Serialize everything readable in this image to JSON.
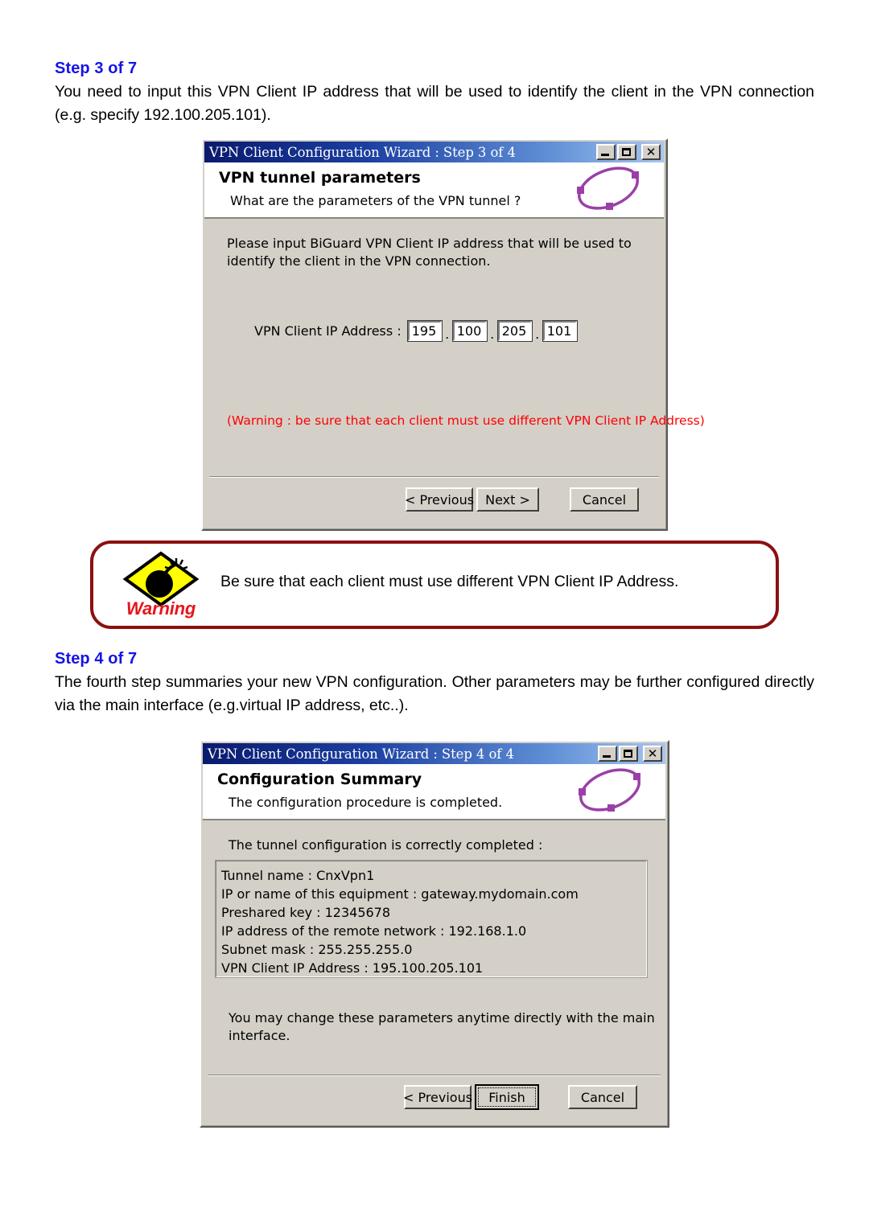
{
  "document": {
    "step3": {
      "heading": "Step 3 of 7",
      "paragraph": "You need to input this VPN Client IP address that will be used to identify the client in the VPN connection (e.g. specify 192.100.205.101)."
    },
    "step4": {
      "heading": "Step 4 of 7",
      "paragraph": "The fourth step summaries your new VPN configuration. Other parameters may be further configured directly via the main interface (e.g.virtual IP address, etc..)."
    }
  },
  "warning_callout": {
    "label": "Warning",
    "text": "Be sure that each client must use different VPN Client IP Address.",
    "icon": "bomb-warning-icon",
    "border_color": "#8c1010",
    "label_color": "#e8141b",
    "diamond_color": "#ffff00"
  },
  "dialog_step3": {
    "titlebar": {
      "title": "VPN Client Configuration Wizard : Step 3 of 4",
      "minimize_icon": "minimize-icon",
      "maximize_icon": "maximize-icon",
      "close_icon": "close-icon"
    },
    "header": {
      "title": "VPN tunnel parameters",
      "subtitle": "What are the parameters of the VPN tunnel ?",
      "logo_icon": "vpn-tunnel-ellipse-icon"
    },
    "instruction": "Please input BiGuard VPN Client IP address that will be used to identify the client in the VPN connection.",
    "ip_field": {
      "label": "VPN Client IP Address :",
      "octet1": "195",
      "octet2": "100",
      "octet3": "205",
      "octet4": "101",
      "separator": "."
    },
    "warning_text": "(Warning : be sure that each client must use different VPN Client IP Address)",
    "warning_color": "#ff0000",
    "buttons": {
      "previous": "< Previous",
      "next": "Next >",
      "cancel": "Cancel"
    }
  },
  "dialog_step4": {
    "titlebar": {
      "title": "VPN Client Configuration Wizard : Step 4 of 4",
      "minimize_icon": "minimize-icon",
      "maximize_icon": "maximize-icon",
      "close_icon": "close-icon"
    },
    "header": {
      "title": "Configuration Summary",
      "subtitle": "The configuration procedure is completed.",
      "logo_icon": "vpn-tunnel-ellipse-icon"
    },
    "panel_caption": "The tunnel configuration is correctly completed :",
    "summary_lines": [
      "Tunnel name : CnxVpn1",
      "IP or name of this equipment : gateway.mydomain.com",
      "Preshared key : 12345678",
      "IP address of the remote network : 192.168.1.0",
      "Subnet mask : 255.255.255.0",
      "VPN Client IP Address : 195.100.205.101"
    ],
    "footer_note": "You may change these parameters anytime directly with the main interface.",
    "buttons": {
      "previous": "< Previous",
      "finish": "Finish",
      "cancel": "Cancel"
    }
  }
}
